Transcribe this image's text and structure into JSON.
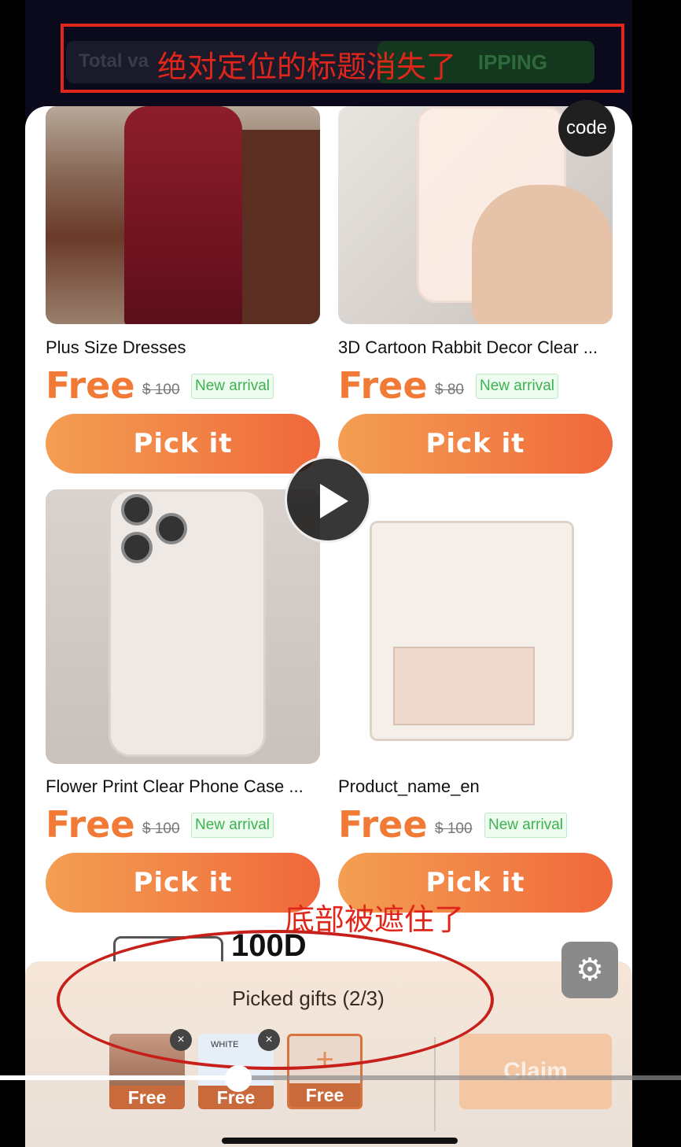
{
  "background_header": {
    "total_label": "Total va",
    "shipping_label": "IPPING"
  },
  "annotations": {
    "title_note": "绝对定位的标题消失了",
    "bottom_note": "底部被遮住了"
  },
  "code_badge": "code",
  "products": [
    {
      "name": "Plus Size Dresses",
      "price": "Free",
      "original": "$ 100",
      "tag": "New arrival",
      "button": "Pick it"
    },
    {
      "name": "3D Cartoon Rabbit Decor Clear ...",
      "price": "Free",
      "original": "$ 80",
      "tag": "New arrival",
      "button": "Pick it"
    },
    {
      "name": "Flower Print Clear Phone Case ...",
      "price": "Free",
      "original": "$ 100",
      "tag": "New arrival",
      "button": "Pick it"
    },
    {
      "name": "Product_name_en",
      "price": "Free",
      "original": "$ 100",
      "tag": "New arrival",
      "button": "Pick it"
    }
  ],
  "next_product_partial_text": "100D",
  "footer": {
    "title": "Picked gifts (2/3)",
    "thumbs": [
      {
        "label": "Free",
        "removable": true
      },
      {
        "label": "Free",
        "removable": true,
        "brand": "WHITE"
      },
      {
        "label": "Free",
        "removable": false,
        "placeholder": "+"
      }
    ],
    "remove_glyph": "×",
    "claim_label": "Claim"
  },
  "video": {
    "progress": 0.35
  },
  "colors": {
    "accent_orange": "#f07a36",
    "tag_green": "#3cb250",
    "annotation_red": "#e0261a"
  }
}
